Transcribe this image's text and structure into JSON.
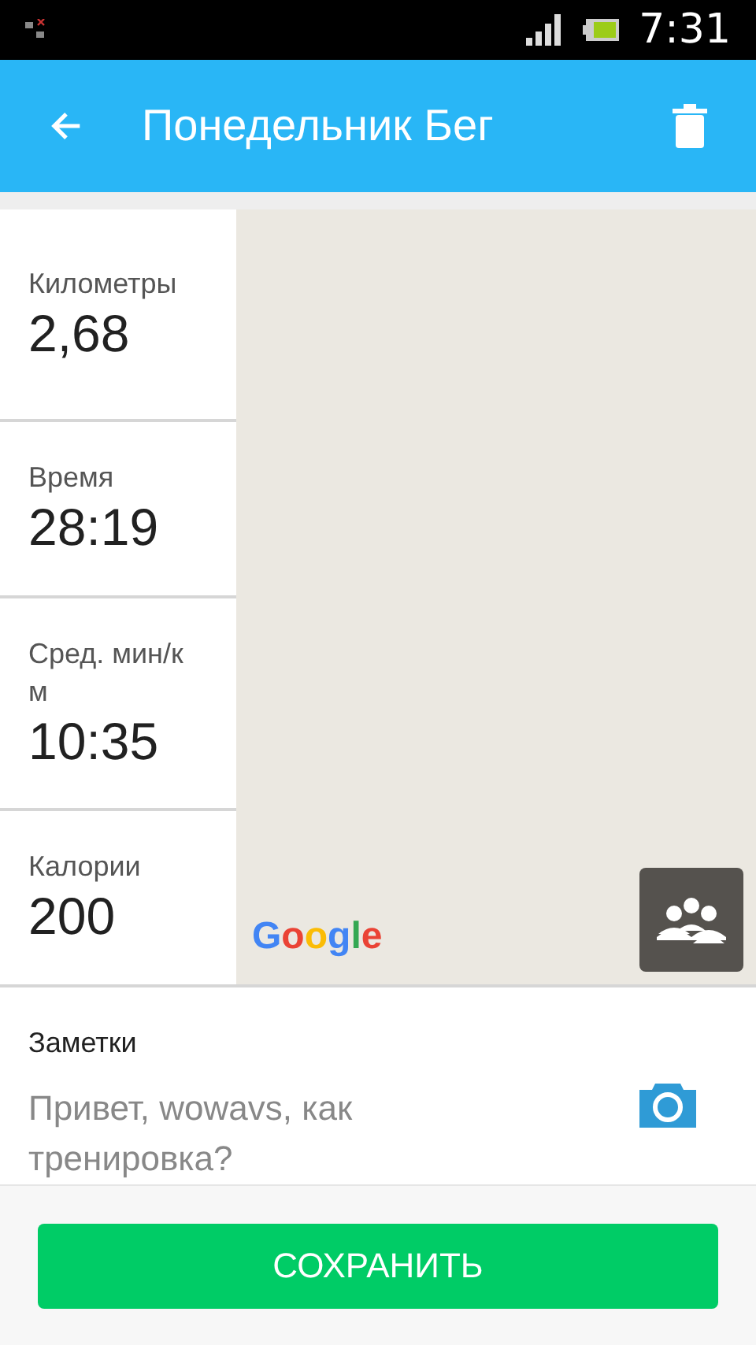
{
  "status_bar": {
    "time": "7:31"
  },
  "app_bar": {
    "title": "Понедельник Бег"
  },
  "stats": [
    {
      "label": "Километры",
      "value": "2,68"
    },
    {
      "label": "Время",
      "value": "28:19"
    },
    {
      "label": "Сред. мин/км",
      "value": "10:35"
    },
    {
      "label": "Калории",
      "value": "200"
    }
  ],
  "map": {
    "attribution": "Google"
  },
  "notes": {
    "label": "Заметки",
    "placeholder": "Привет, wowavs, как тренировка?"
  },
  "save_button": {
    "label": "СОХРАНИТЬ"
  }
}
